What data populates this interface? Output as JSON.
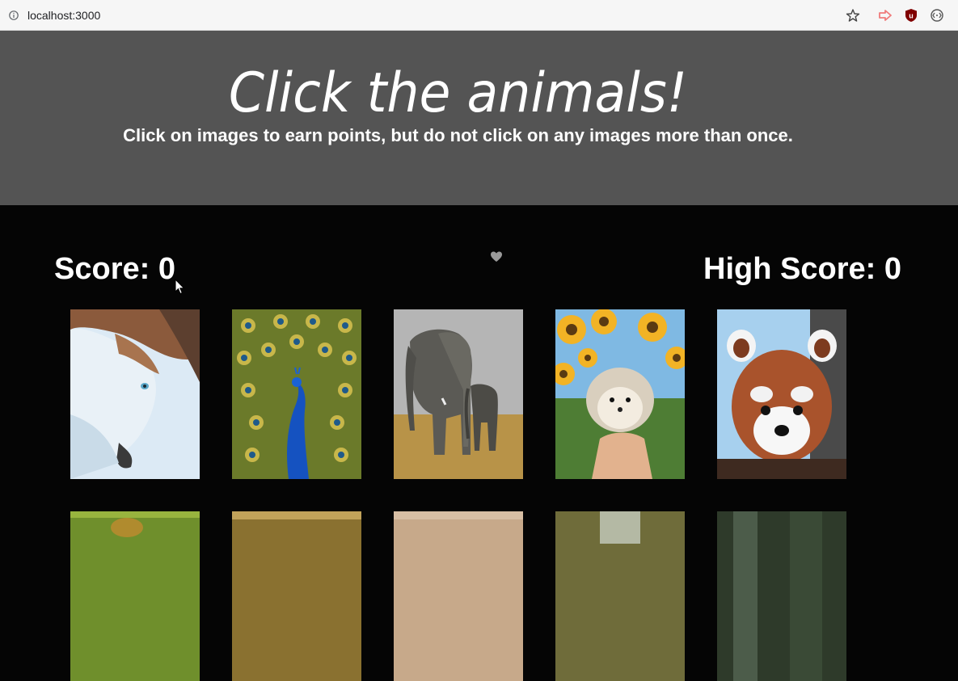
{
  "browser": {
    "url": "localhost:3000",
    "icons": [
      "info-icon",
      "star-icon",
      "extension-arrow-icon",
      "ublock-icon",
      "extension-circle-icon"
    ]
  },
  "header": {
    "title": "Click the animals!",
    "subtitle": "Click on images to earn points, but do not click on any images more than once."
  },
  "scoreboard": {
    "score": "Score: 0",
    "high_score": "High Score: 0",
    "center_icon": "heart-icon"
  },
  "cards": [
    {
      "animal": "husky"
    },
    {
      "animal": "peacock"
    },
    {
      "animal": "elephants"
    },
    {
      "animal": "hedgehog"
    },
    {
      "animal": "red-panda"
    },
    {
      "animal": "animal-6"
    },
    {
      "animal": "animal-7"
    },
    {
      "animal": "animal-8"
    },
    {
      "animal": "animal-9"
    },
    {
      "animal": "animal-10"
    }
  ],
  "colors": {
    "header_bg": "#545454",
    "page_bg": "#050505",
    "text": "#ffffff"
  }
}
